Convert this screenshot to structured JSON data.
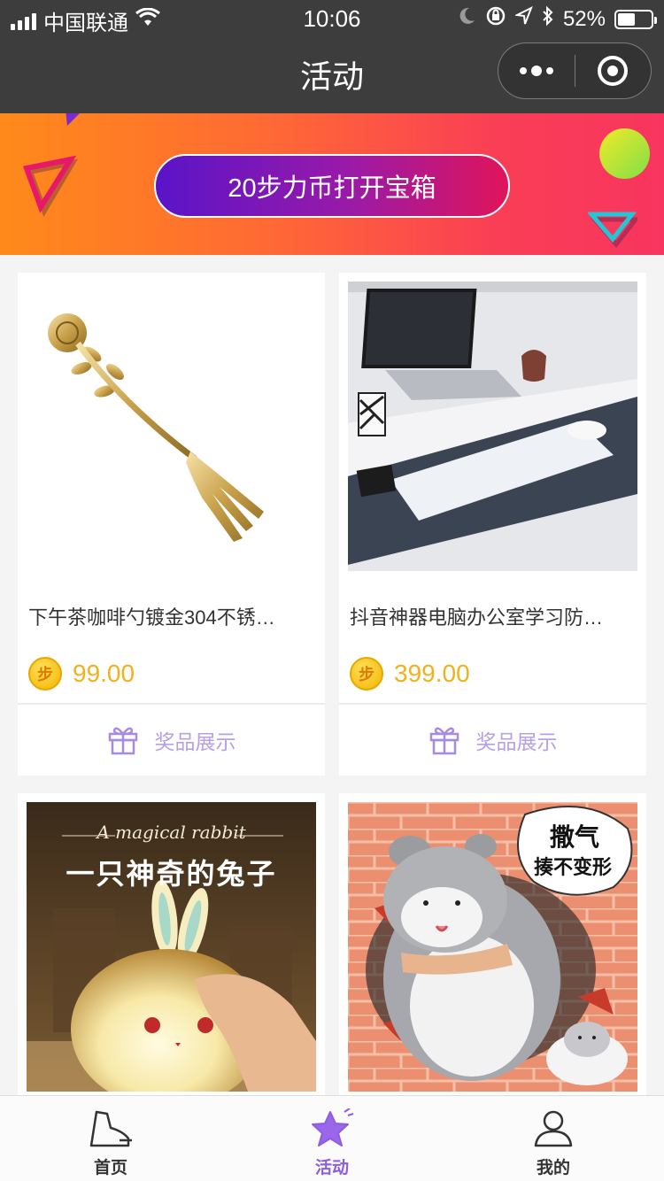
{
  "status_bar": {
    "carrier": "中国联通",
    "time": "10:06",
    "battery": "52%",
    "battery_level": 0.52
  },
  "nav": {
    "title": "活动"
  },
  "banner": {
    "cta_label": "20步力币打开宝箱"
  },
  "products": [
    {
      "title": "下午茶咖啡勺镀金304不锈…",
      "price": "99.00",
      "action_label": "奖品展示"
    },
    {
      "title": "抖音神器电脑办公室学习防…",
      "price": "399.00",
      "action_label": "奖品展示"
    },
    {
      "title": "",
      "price": "",
      "action_label": "",
      "image_text_en": "A magical rabbit",
      "image_text_cn": "一只神奇的兔子"
    },
    {
      "title": "",
      "price": "",
      "action_label": "",
      "image_text_line1": "撒气",
      "image_text_line2": "揍不变形"
    }
  ],
  "coin_glyph": "步",
  "tabbar": {
    "items": [
      {
        "label": "首页",
        "icon": "shoe-icon",
        "active": false
      },
      {
        "label": "活动",
        "icon": "star-icon",
        "active": true
      },
      {
        "label": "我的",
        "icon": "user-icon",
        "active": false
      }
    ]
  },
  "colors": {
    "accent": "#8c5ce3",
    "price": "#f0b21b",
    "banner_start": "#ff8a1a",
    "banner_end": "#f8355e"
  }
}
